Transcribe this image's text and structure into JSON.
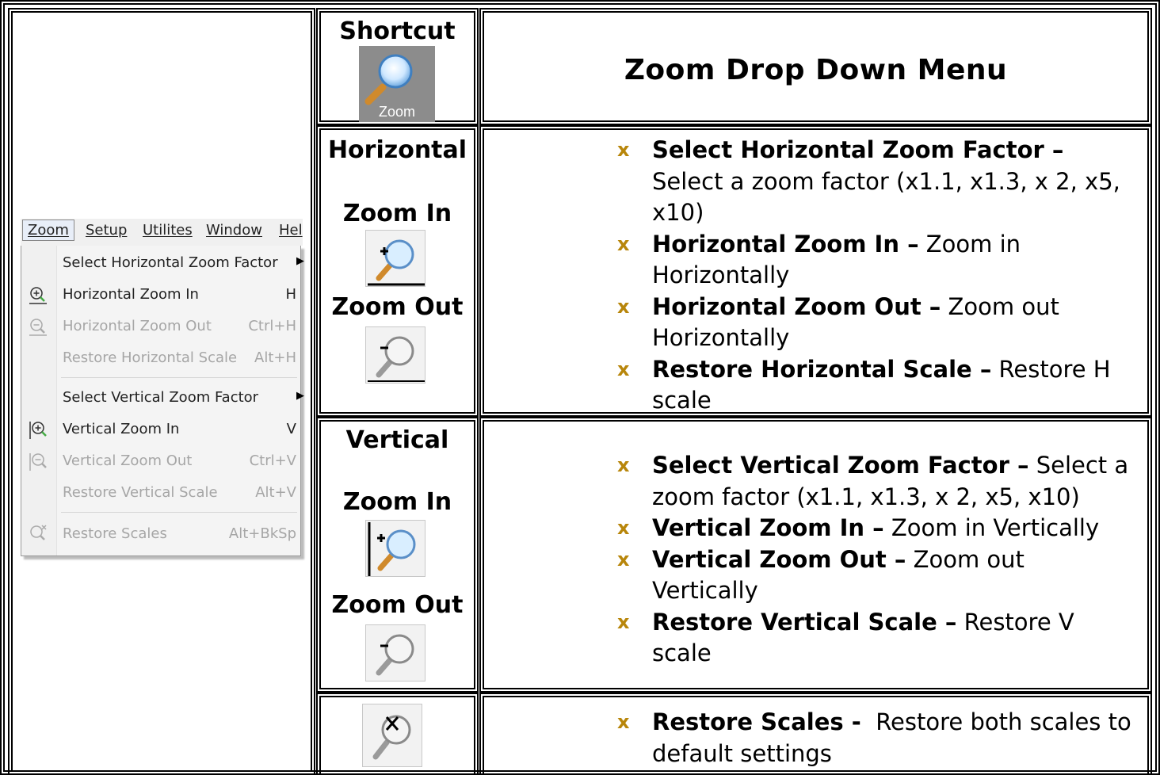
{
  "menu_screenshot": {
    "menubar": [
      "Zoom",
      "Setup",
      "Utilites",
      "Window",
      "Hel"
    ],
    "items": [
      {
        "label": "Select Horizontal Zoom Factor",
        "shortcut": "",
        "submenu": true,
        "enabled": true,
        "icon": ""
      },
      {
        "label": "Horizontal Zoom In",
        "shortcut": "H",
        "submenu": false,
        "enabled": true,
        "icon": "horizontal-zoom-in-icon"
      },
      {
        "label": "Horizontal Zoom Out",
        "shortcut": "Ctrl+H",
        "submenu": false,
        "enabled": false,
        "icon": "horizontal-zoom-out-icon"
      },
      {
        "label": "Restore Horizontal Scale",
        "shortcut": "Alt+H",
        "submenu": false,
        "enabled": false,
        "icon": ""
      },
      {
        "label": "Select Vertical Zoom Factor",
        "shortcut": "",
        "submenu": true,
        "enabled": true,
        "icon": ""
      },
      {
        "label": "Vertical Zoom In",
        "shortcut": "V",
        "submenu": false,
        "enabled": true,
        "icon": "vertical-zoom-in-icon"
      },
      {
        "label": "Vertical Zoom Out",
        "shortcut": "Ctrl+V",
        "submenu": false,
        "enabled": false,
        "icon": "vertical-zoom-out-icon"
      },
      {
        "label": "Restore Vertical Scale",
        "shortcut": "Alt+V",
        "submenu": false,
        "enabled": false,
        "icon": ""
      },
      {
        "label": "Restore Scales",
        "shortcut": "Alt+BkSp",
        "submenu": false,
        "enabled": false,
        "icon": "restore-scales-icon"
      }
    ]
  },
  "shortcut": {
    "heading": "Shortcut",
    "icon_label": "Zoom",
    "icon": "magnifier-icon"
  },
  "title": "Zoom Drop Down Menu",
  "horizontal": {
    "heading": "Horizontal",
    "zoom_in": "Zoom In",
    "zoom_out": "Zoom Out"
  },
  "vertical": {
    "heading": "Vertical",
    "zoom_in": "Zoom In",
    "zoom_out": "Zoom Out"
  },
  "bullet_glyph": "x",
  "bullet_color": "#b8860b",
  "horizontal_items": [
    {
      "term": "Select Horizontal Zoom Factor –",
      "desc": "Select a zoom factor (x1.1, x1.3, x 2, x5, x10)"
    },
    {
      "term": "Horizontal Zoom In –",
      "desc": "Zoom in Horizontally"
    },
    {
      "term": "Horizontal Zoom Out –",
      "desc": "Zoom out Horizontally"
    },
    {
      "term": "Restore Horizontal Scale –",
      "desc": "Restore H scale"
    }
  ],
  "vertical_items": [
    {
      "term": "Select Vertical Zoom Factor –",
      "desc": "Select a zoom factor (x1.1, x1.3, x 2, x5, x10)"
    },
    {
      "term": "Vertical Zoom In –",
      "desc": "Zoom in Vertically"
    },
    {
      "term": "Vertical Zoom Out –",
      "desc": "Zoom out Vertically"
    },
    {
      "term": "Restore Vertical Scale –",
      "desc": "Restore V scale"
    }
  ],
  "restore_items": [
    {
      "term": "Restore Scales -",
      "desc": "Restore both scales to default settings"
    }
  ]
}
